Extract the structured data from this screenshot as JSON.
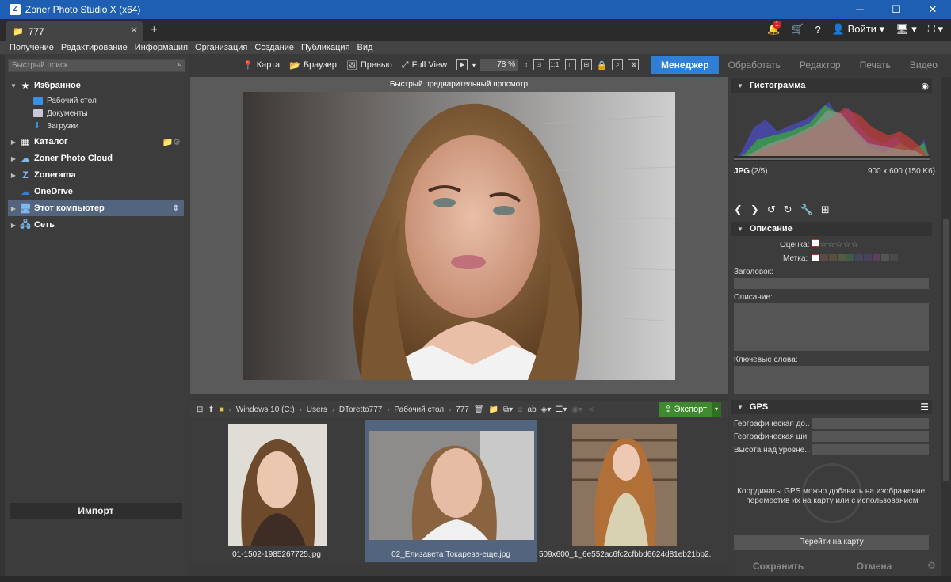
{
  "window": {
    "title": "Zoner Photo Studio X (x64)",
    "minimize": "─",
    "maximize": "☐",
    "close": "✕"
  },
  "tabs": {
    "doc_tab": "777",
    "close": "✕",
    "new_tab": "+",
    "login": "Войти",
    "notify_count": "1"
  },
  "menu": [
    "Получение",
    "Редактирование",
    "Информация",
    "Организация",
    "Создание",
    "Публикация",
    "Вид"
  ],
  "search": {
    "placeholder": "Быстрый поиск"
  },
  "tree": {
    "favorites": "Избранное",
    "desktop": "Рабочий стол",
    "documents": "Документы",
    "downloads": "Загрузки",
    "catalog": "Каталог",
    "cloud": "Zoner Photo Cloud",
    "zonerama": "Zonerama",
    "onedrive": "OneDrive",
    "this_pc": "Этот компьютер",
    "network": "Сеть"
  },
  "import_label": "Импорт",
  "toolbar": {
    "map": "Карта",
    "browser": "Браузер",
    "preview": "Превью",
    "fullview": "Full View",
    "zoom": "78 %"
  },
  "modules": {
    "manager": "Менеджер",
    "develop": "Обработать",
    "editor": "Редактор",
    "print": "Печать",
    "video": "Видео"
  },
  "preview": {
    "label": "Быстрый предварительный просмотр"
  },
  "breadcrumb": [
    "Windows 10 (C:)",
    "Users",
    "DToretto777",
    "Рабочий стол",
    "777"
  ],
  "export_label": "Экспорт",
  "thumbnails": [
    {
      "caption": "01-1502-1985267725.jpg"
    },
    {
      "caption": "02_Елизавета Токарева-еще.jpg"
    },
    {
      "caption": "509x600_1_6e552ac6fc2cfbbd6624d81eb21bb2..."
    }
  ],
  "right": {
    "histogram_title": "Гистограмма",
    "format": "JPG",
    "index": "(2/5)",
    "dimensions": "900 x 600 (150 K6)",
    "description_title": "Описание",
    "rating_label": "Оценка:",
    "label_label": "Метка:",
    "heading_label": "Заголовок:",
    "desc_label": "Описание:",
    "keywords_label": "Ключевые слова:",
    "gps_title": "GPS",
    "gps_lat": "Географическая до...",
    "gps_lon": "Географическая ши...",
    "gps_alt": "Высота над уровне...",
    "gps_note": "Координаты GPS можно добавить на изображение, переместив их на карту или с использованием",
    "go_map": "Перейти на карту",
    "save": "Сохранить",
    "cancel": "Отмена"
  },
  "colors": {
    "accent": "#2f7fd6",
    "titlebar": "#1e5fb4",
    "export": "#3f8a2f"
  }
}
